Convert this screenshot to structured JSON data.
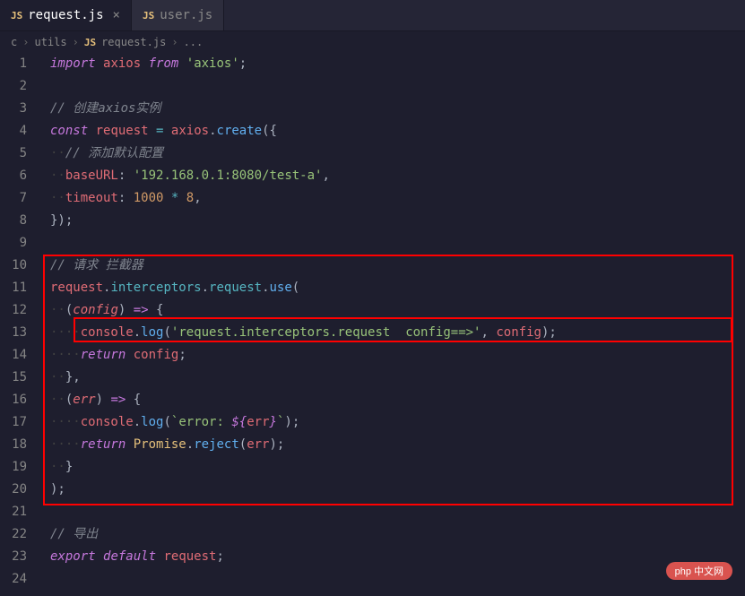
{
  "tabs": [
    {
      "icon": "JS",
      "label": "request.js",
      "active": true,
      "closeable": true
    },
    {
      "icon": "JS",
      "label": "user.js",
      "active": false,
      "closeable": false
    }
  ],
  "breadcrumb": {
    "items": [
      "c",
      "utils",
      "request.js",
      "..."
    ],
    "iconIndex": 2,
    "icon": "JS"
  },
  "gutter": {
    "start": 1,
    "end": 24
  },
  "code": {
    "l1": {
      "import": "import",
      "var": "axios",
      "from": "from",
      "str": "'axios'",
      "semi": ";"
    },
    "l3": {
      "comment": "// 创建axios实例"
    },
    "l4": {
      "const": "const",
      "var": "request",
      "eq": "=",
      "obj": "axios",
      "dot": ".",
      "fn": "create",
      "open": "({"
    },
    "l5": {
      "comment": "// 添加默认配置"
    },
    "l6": {
      "key": "baseURL",
      "colon": ":",
      "str": "'192.168.0.1:8080/test-a'",
      "comma": ","
    },
    "l7": {
      "key": "timeout",
      "colon": ":",
      "num1": "1000",
      "op": "*",
      "num2": "8",
      "comma": ","
    },
    "l8": {
      "close": "});"
    },
    "l10": {
      "comment": "// 请求 拦截器"
    },
    "l11": {
      "obj": "request",
      "dot1": ".",
      "p1": "interceptors",
      "dot2": ".",
      "p2": "request",
      "dot3": ".",
      "fn": "use",
      "open": "("
    },
    "l12": {
      "open": "(",
      "param": "config",
      "close": ")",
      "arrow": "=>",
      "brace": "{"
    },
    "l13": {
      "obj": "console",
      "dot": ".",
      "fn": "log",
      "open": "(",
      "str": "'request.interceptors.request  config==>'",
      "comma": ",",
      "arg": "config",
      "close": ");"
    },
    "l14": {
      "ret": "return",
      "var": "config",
      "semi": ";"
    },
    "l15": {
      "close": "},"
    },
    "l16": {
      "open": "(",
      "param": "err",
      "close": ")",
      "arrow": "=>",
      "brace": "{"
    },
    "l17": {
      "obj": "console",
      "dot": ".",
      "fn": "log",
      "open": "(",
      "tick1": "`",
      "txt": "error: ",
      "dopen": "${",
      "var": "err",
      "dclose": "}",
      "tick2": "`",
      "close": ");"
    },
    "l18": {
      "ret": "return",
      "cls": "Promise",
      "dot": ".",
      "fn": "reject",
      "open": "(",
      "arg": "err",
      "close": ");"
    },
    "l19": {
      "close": "}"
    },
    "l20": {
      "close": ");"
    },
    "l22": {
      "comment": "// 导出"
    },
    "l23": {
      "exp": "export",
      "def": "default",
      "var": "request",
      "semi": ";"
    }
  },
  "watermark": "php 中文网"
}
